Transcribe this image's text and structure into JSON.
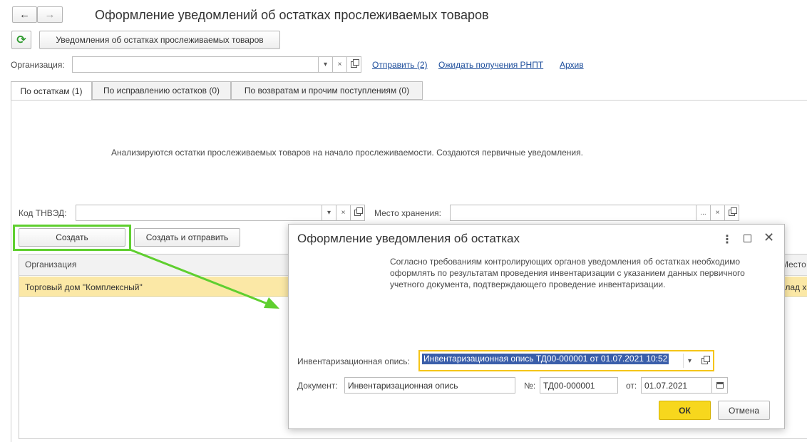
{
  "window": {
    "title": "Оформление уведомлений об остатках прослеживаемых товаров",
    "back_icon": "←",
    "forward_icon": "→"
  },
  "toolbar": {
    "refresh_icon": "⟳",
    "notifications_button": "Уведомления об остатках прослеживаемых товаров"
  },
  "org_row": {
    "label": "Организация:",
    "value": "",
    "links": [
      "Отправить (2)",
      "Ожидать получения РНПТ",
      "Архив"
    ]
  },
  "tabs": [
    {
      "label": "По остаткам (1)",
      "active": true
    },
    {
      "label": "По исправлению остатков (0)",
      "active": false
    },
    {
      "label": "По возвратам и прочим поступлениям (0)",
      "active": false
    }
  ],
  "info_text": "Анализируются остатки прослеживаемых товаров на начало прослеживаемости. Создаются первичные уведомления.",
  "filters": {
    "tnved_label": "Код ТНВЭД:",
    "tnved_value": "",
    "storage_label": "Место хранения:",
    "storage_value": ""
  },
  "actions": {
    "create": "Создать",
    "create_and_send": "Создать и отправить"
  },
  "table": {
    "columns": [
      "Организация",
      "Место х"
    ],
    "rows": [
      {
        "organization": "Торговый дом \"Комплексный\"",
        "storage": "клад х"
      }
    ]
  },
  "dialog": {
    "title": "Оформление уведомления об остатках",
    "message": "Согласно требованиям контролирующих органов уведомления об остатках необходимо оформлять по результатам проведения инвентаризации с указанием данных первичного учетного документа, подтверждающего проведение инвентаризации.",
    "inventory_label": "Инвентаризационная опись:",
    "inventory_value": "Инвентаризационная опись ТД00-000001 от 01.07.2021 10:52",
    "document_label": "Документ:",
    "document_value": "Инвентаризационная опись",
    "number_label": "№:",
    "number_value": "ТД00-000001",
    "date_label": "от:",
    "date_value": "01.07.2021",
    "ok": "ОК",
    "cancel": "Отмена"
  },
  "colors": {
    "highlight_green": "#5fcf2f",
    "row_selected": "#fbe8a6",
    "ok_yellow": "#f7d71d",
    "focus_border": "#f5c518",
    "link": "#1c4d9b"
  }
}
